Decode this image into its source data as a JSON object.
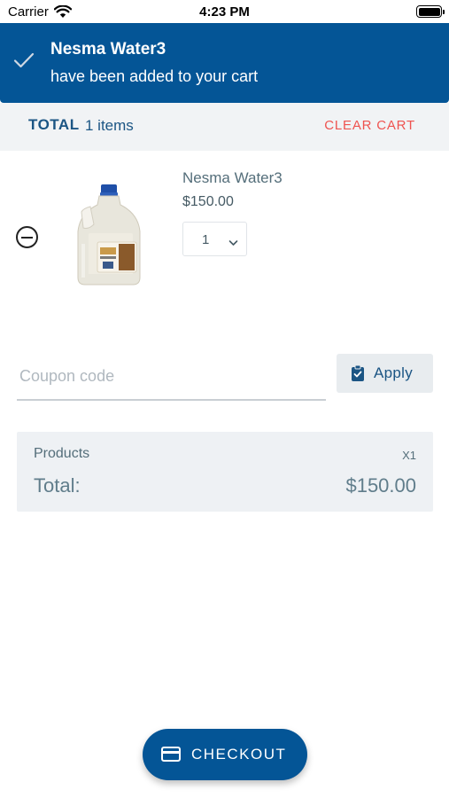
{
  "status_bar": {
    "carrier": "Carrier",
    "time": "4:23 PM",
    "icons": [
      "wifi-icon",
      "battery-icon"
    ]
  },
  "toast": {
    "title": "Nesma Water3",
    "message": "have been added to your cart",
    "icon": "check-icon",
    "background": "#045596"
  },
  "cart_header": {
    "total_label": "TOTAL",
    "items_count": "1 items",
    "clear_label": "CLEAR CART"
  },
  "cart_items": [
    {
      "name": "Nesma Water3",
      "price": "$150.00",
      "quantity": "1",
      "image": "water-gallon-image"
    }
  ],
  "coupon": {
    "placeholder": "Coupon code",
    "value": "",
    "apply_label": "Apply"
  },
  "summary": {
    "products_label": "Products",
    "products_qty": "X1",
    "total_label": "Total:",
    "total_value": "$150.00"
  },
  "checkout": {
    "label": "CHECKOUT",
    "icon": "credit-card-icon"
  },
  "colors": {
    "brand": "#045596",
    "danger": "#ef5350",
    "panel": "#eef1f4"
  }
}
